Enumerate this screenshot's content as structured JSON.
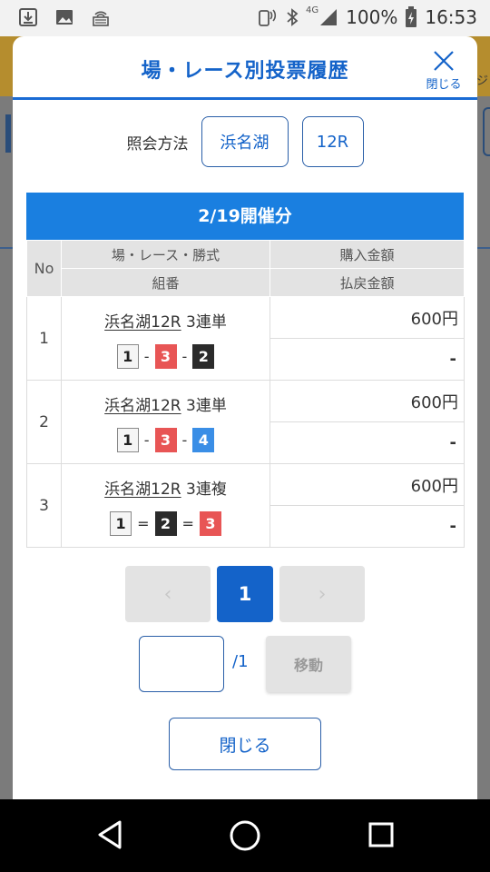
{
  "status_bar": {
    "network": "4G",
    "battery": "100%",
    "time": "16:53"
  },
  "background": {
    "side_text": "ジ"
  },
  "modal": {
    "title": "場・レース別投票履歴",
    "close_label": "閉じる",
    "method_label": "照会方法",
    "venue": "浜名湖",
    "race": "12R",
    "date_header": "2/19開催分",
    "table": {
      "col_no": "No",
      "col_race": "場・レース・勝式",
      "col_combo": "組番",
      "col_purchase": "購入金額",
      "col_payout": "払戻金額",
      "rows": [
        {
          "no": "1",
          "race": "浜名湖12R",
          "bet_type": "3連単",
          "c1": "1",
          "s1": "-",
          "c2": "3",
          "s2": "-",
          "c3": "2",
          "purchase": "600円",
          "payout": "-"
        },
        {
          "no": "2",
          "race": "浜名湖12R",
          "bet_type": "3連単",
          "c1": "1",
          "s1": "-",
          "c2": "3",
          "s2": "-",
          "c3": "4",
          "purchase": "600円",
          "payout": "-"
        },
        {
          "no": "3",
          "race": "浜名湖12R",
          "bet_type": "3連複",
          "c1": "1",
          "s1": "=",
          "c2": "2",
          "s2": "=",
          "c3": "3",
          "purchase": "600円",
          "payout": "-"
        }
      ]
    },
    "pager": {
      "prev": "‹",
      "current": "1",
      "next": "›"
    },
    "jump": {
      "input_value": "",
      "total": "/1",
      "button": "移動"
    },
    "close_button": "閉じる"
  },
  "colors": {
    "accent": "#1463c9",
    "header_band": "#1a7fe0",
    "boat_1": "#f5f5f5",
    "boat_2": "#2b2b2b",
    "boat_3": "#e85555",
    "boat_4": "#3a8ee6"
  }
}
